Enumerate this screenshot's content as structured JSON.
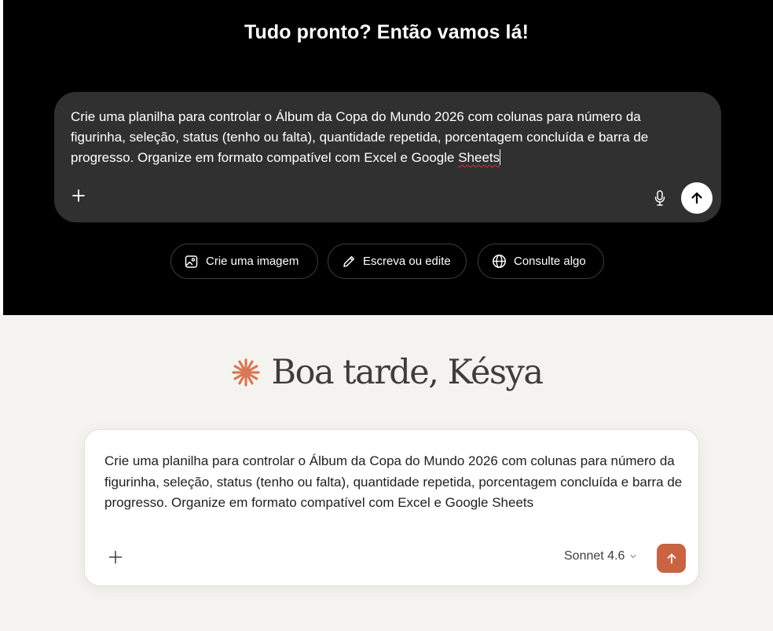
{
  "top": {
    "title": "Tudo pronto? Então vamos lá!",
    "prompt_text_main": "Crie uma planilha para controlar o Álbum da Copa do Mundo 2026 com colunas para número da figurinha, seleção, status (tenho ou falta), quantidade repetida, porcentagem concluída e barra de progresso. Organize em formato compatível com Excel e Google ",
    "prompt_text_flagged_word": "Sheets",
    "icons": {
      "add": "plus-icon",
      "mic": "microphone-icon",
      "send": "arrow-up-icon"
    },
    "suggestions": [
      {
        "label": "Crie uma imagem",
        "icon": "image-edit-icon"
      },
      {
        "label": "Escreva ou edite",
        "icon": "pencil-icon"
      },
      {
        "label": "Consulte algo",
        "icon": "globe-icon"
      }
    ]
  },
  "bottom": {
    "greeting": "Boa tarde, Késya",
    "prompt_text": "Crie uma planilha para controlar o Álbum da Copa do Mundo 2026 com colunas para número da figurinha, seleção, status (tenho ou falta), quantidade repetida, porcentagem concluída e barra de progresso. Organize em formato compatível com Excel e Google Sheets",
    "model": "Sonnet 4.6",
    "icons": {
      "logo": "asterisk-spark-icon",
      "add": "plus-icon",
      "model_dropdown": "chevron-down-icon",
      "send": "arrow-up-icon"
    }
  },
  "colors": {
    "dark_bg": "#000000",
    "dark_input_bg": "#303030",
    "light_bg": "#f4f3ef",
    "accent": "#c96442",
    "logo": "#d97757"
  }
}
